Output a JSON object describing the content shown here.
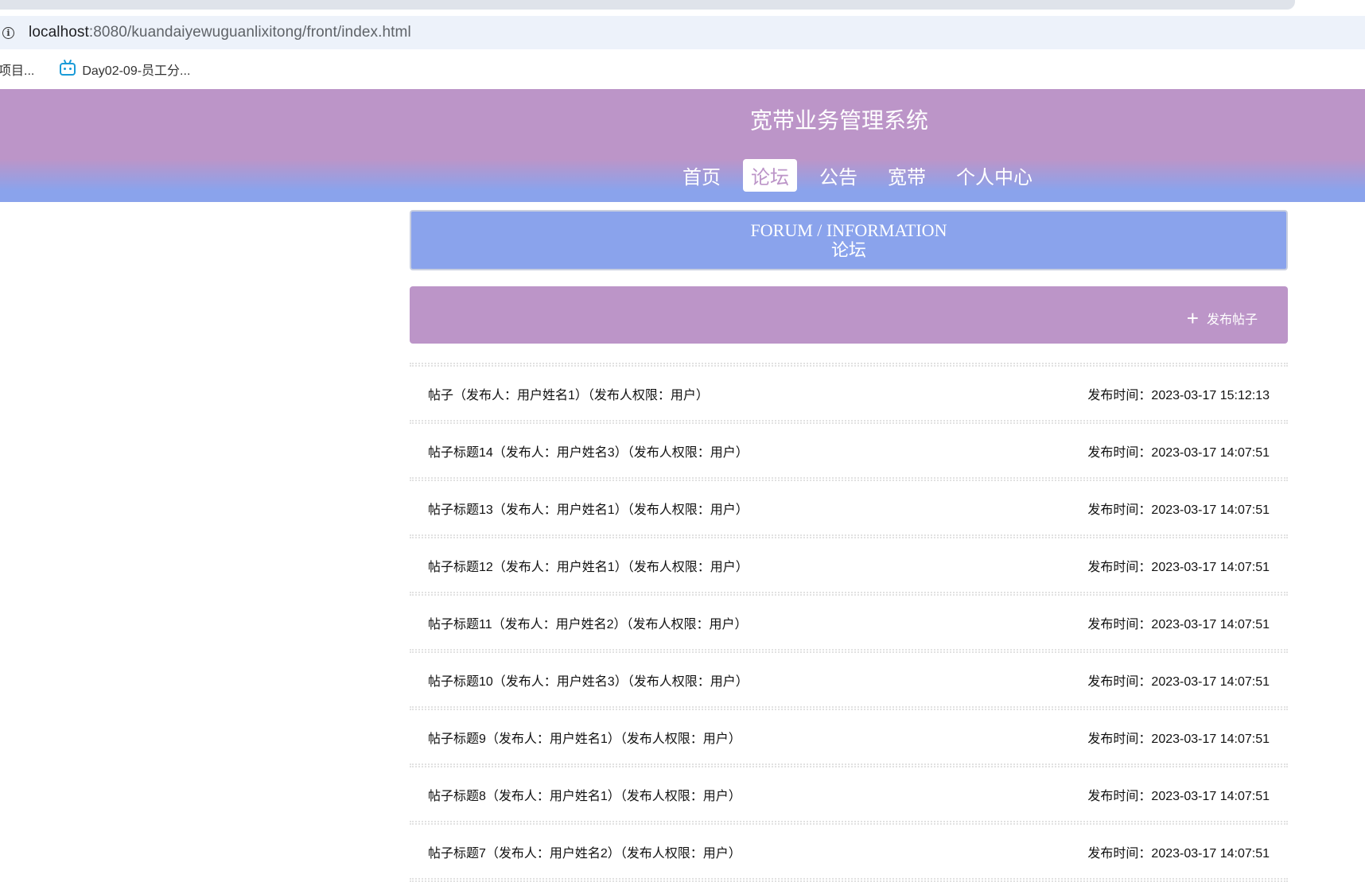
{
  "browser": {
    "url_host": "localhost",
    "url_path": ":8080/kuandaiyewuguanlixitong/front/index.html",
    "bookmarks": [
      "项目...",
      "Day02-09-员工分..."
    ]
  },
  "site": {
    "title": "宽带业务管理系统",
    "nav": [
      "首页",
      "论坛",
      "公告",
      "宽带",
      "个人中心"
    ],
    "active_nav": "论坛"
  },
  "forum": {
    "header_en": "FORUM / INFORMATION",
    "header_cn": "论坛",
    "add_button": "发布帖子",
    "posts": [
      {
        "title": "帖子（发布人：用户姓名1）（发布人权限：用户）",
        "time": "发布时间：2023-03-17 15:12:13"
      },
      {
        "title": "帖子标题14（发布人：用户姓名3）（发布人权限：用户）",
        "time": "发布时间：2023-03-17 14:07:51"
      },
      {
        "title": "帖子标题13（发布人：用户姓名1）（发布人权限：用户）",
        "time": "发布时间：2023-03-17 14:07:51"
      },
      {
        "title": "帖子标题12（发布人：用户姓名1）（发布人权限：用户）",
        "time": "发布时间：2023-03-17 14:07:51"
      },
      {
        "title": "帖子标题11（发布人：用户姓名2）（发布人权限：用户）",
        "time": "发布时间：2023-03-17 14:07:51"
      },
      {
        "title": "帖子标题10（发布人：用户姓名3）（发布人权限：用户）",
        "time": "发布时间：2023-03-17 14:07:51"
      },
      {
        "title": "帖子标题9（发布人：用户姓名1）（发布人权限：用户）",
        "time": "发布时间：2023-03-17 14:07:51"
      },
      {
        "title": "帖子标题8（发布人：用户姓名1）（发布人权限：用户）",
        "time": "发布时间：2023-03-17 14:07:51"
      },
      {
        "title": "帖子标题7（发布人：用户姓名2）（发布人权限：用户）",
        "time": "发布时间：2023-03-17 14:07:51"
      }
    ]
  },
  "colors": {
    "primary_purple": "#bc95c8",
    "primary_blue": "#8aa3ec"
  }
}
